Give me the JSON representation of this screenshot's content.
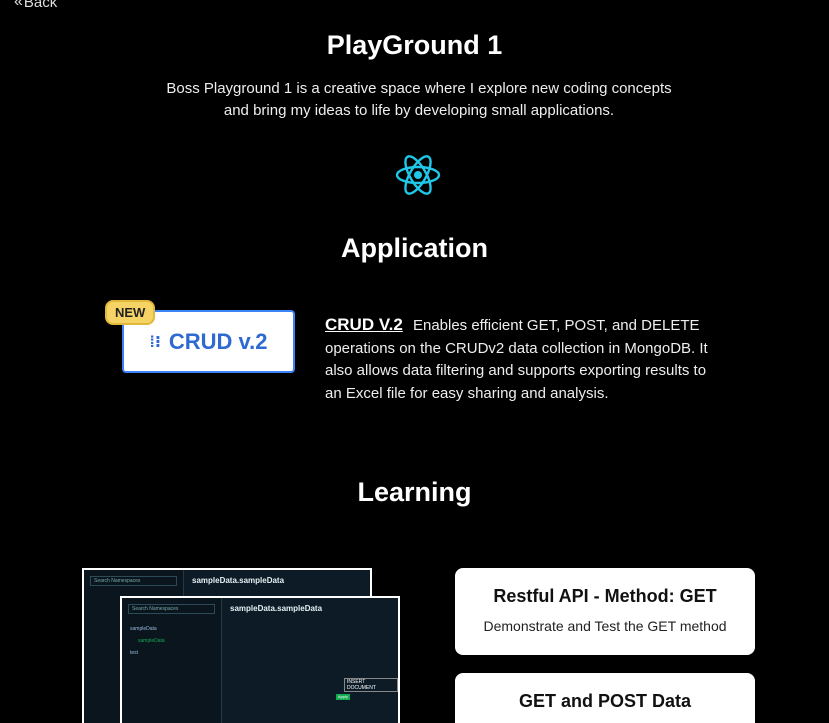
{
  "nav": {
    "back_label": "Back"
  },
  "header": {
    "title": "PlayGround 1",
    "description_line1": "Boss Playground 1 is a creative space where I explore new coding concepts",
    "description_line2": "and bring my ideas to life by developing small applications."
  },
  "icons": {
    "framework_icon": "react-icon",
    "crud_logo": "crud-logo-icon",
    "back_icon": "double-chevron-left-icon"
  },
  "colors": {
    "react": "#1fc8e8",
    "crud_blue": "#2f6ad0",
    "badge": "#f6d365"
  },
  "application": {
    "heading": "Application",
    "card": {
      "badge": "NEW",
      "label": "CRUD v.2",
      "link_text": "CRUD V.2",
      "description": "Enables efficient GET, POST, and DELETE operations on the CRUDv2 data collection in MongoDB. It also allows data filtering and supports exporting results to an Excel file for easy sharing and analysis."
    }
  },
  "learning": {
    "heading": "Learning",
    "preview": {
      "back_title": "sampleData.sampleData",
      "front_title": "sampleData.sampleData",
      "search_placeholder": "Search Namespaces",
      "db_name": "sampleData",
      "collection_name": "sampleData",
      "other_db": "test",
      "insert_label": "INSERT DOCUMENT",
      "apply_label": "Apply"
    },
    "cards": [
      {
        "title": "Restful API - Method: GET",
        "desc": "Demonstrate and Test the GET method"
      },
      {
        "title": "GET and POST Data",
        "desc": ""
      }
    ]
  }
}
